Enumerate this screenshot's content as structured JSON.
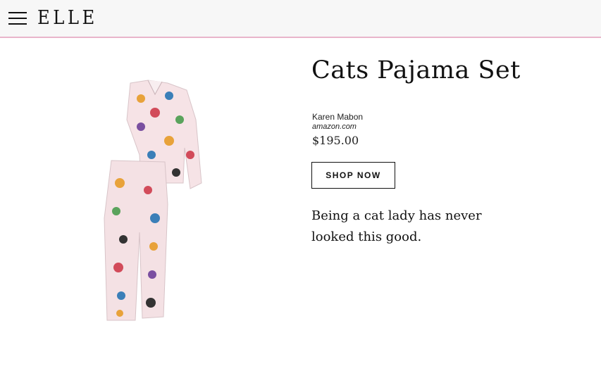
{
  "header": {
    "menu_icon": "hamburger-menu-icon",
    "logo_text": "ELLE",
    "accent_color": "#e9b5cb"
  },
  "product": {
    "title": "Cats Pajama Set",
    "brand": "Karen Mabon",
    "retailer": "amazon.com",
    "price": "$195.00",
    "shop_label": "SHOP NOW",
    "description": "Being a cat lady has never looked this good.",
    "image_alt": "cat-print pajama set"
  }
}
